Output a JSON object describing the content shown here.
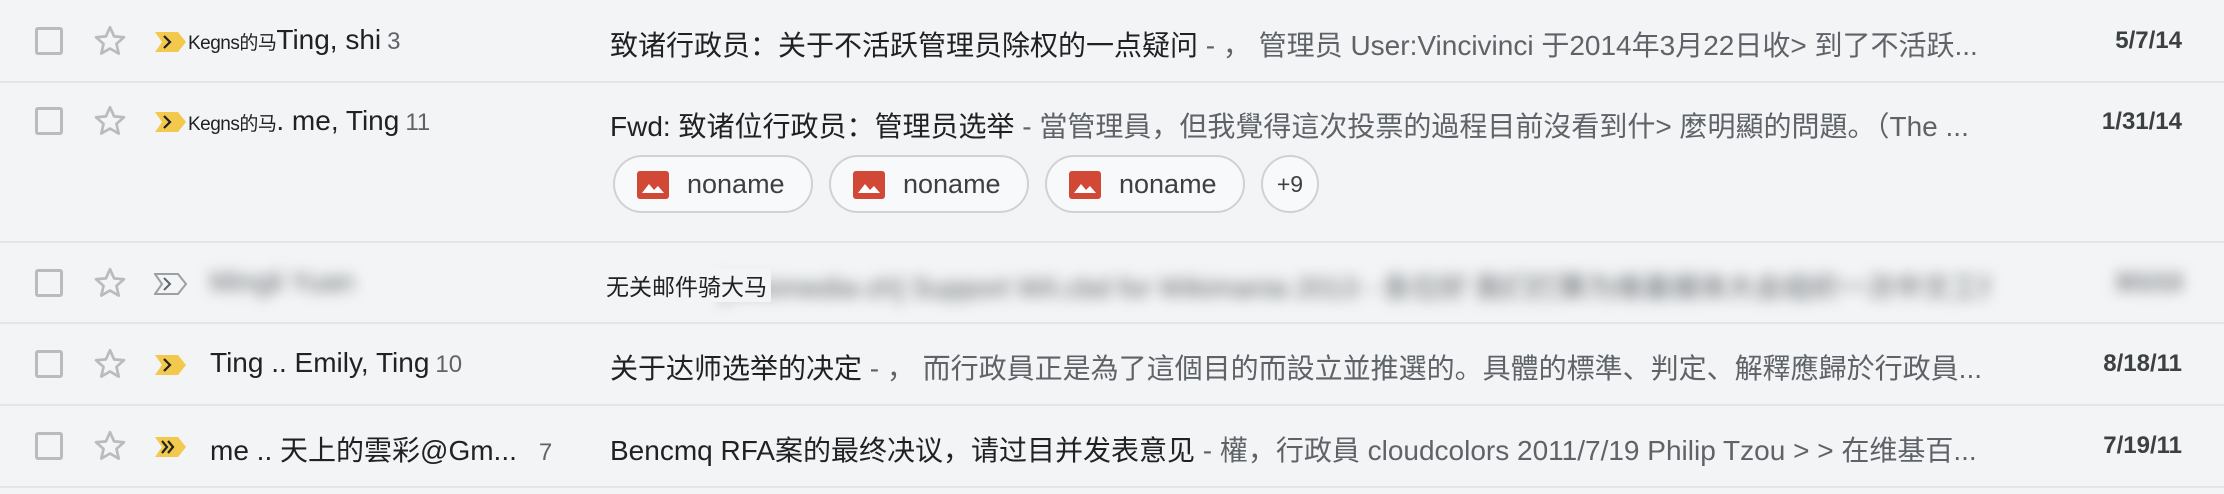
{
  "rows": [
    {
      "sender_prefix": "Kegns的马",
      "sender": "Ting, shi",
      "count": "3",
      "subject": "致诸行政员：关于不活跃管理员除权的一点疑问",
      "snippet": " - ， 管理员 User:Vincivinci 于2014年3月22日收> 到了不活跃...",
      "date": "5/7/14",
      "important": true
    },
    {
      "sender_prefix": "Kegns的马",
      "sender": ". me, Ting",
      "count": "11",
      "subject": "Fwd: 致诸位行政员：管理员选举",
      "snippet": " - 當管理員，但我覺得這次投票的過程目前沒看到什> 麼明顯的問題。（The ...",
      "date": "1/31/14",
      "important": true,
      "attachments": [
        "noname",
        "noname",
        "noname"
      ],
      "more_attachments": "+9"
    },
    {
      "sender": "Mingli Yuan",
      "subject": "[Wikimedia-zh] Support WiI.cbd for Wikimania 2013",
      "snippet": " - 各位好 我们打算为维基媒体大会组织一次中文工作坊 欢迎参与讨论",
      "date": "3/1/13",
      "important": false,
      "overlay_label": "无关邮件骑大马"
    },
    {
      "sender": "Ting .. Emily, Ting",
      "count": "10",
      "subject": "关于达师选举的决定",
      "snippet": " - ， 而行政員正是為了這個目的而設立並推選的。具體的標準、判定、解釋應歸於行政員...",
      "date": "8/18/11",
      "important": true
    },
    {
      "sender": "me .. 天上的雲彩@Gm...",
      "count": "7",
      "subject": "Bencmq RFA案的最终决议，请过目并发表意见",
      "snippet": " - 權，行政員 cloudcolors 2011/7/19 Philip Tzou > > 在维基百...",
      "date": "7/19/11",
      "important": true,
      "important_double": true
    }
  ],
  "colors": {
    "important_marker": "#f2c94c",
    "attachment_icon": "#d14836",
    "background": "#f2f4f5"
  },
  "icons": {
    "checkbox": "checkbox-icon",
    "star": "star-outline-icon",
    "important": "importance-marker-icon",
    "attachment": "image-attachment-icon"
  }
}
